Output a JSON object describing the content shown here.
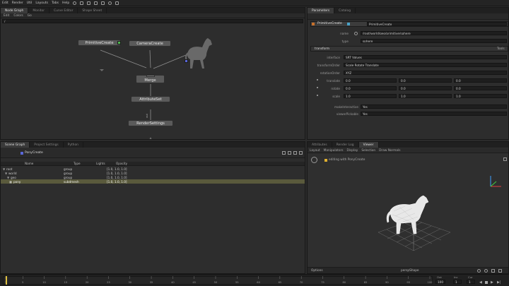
{
  "menu": [
    "Edit",
    "Render",
    "Util",
    "Layouts",
    "Tabs",
    "Help"
  ],
  "node_graph": {
    "tabs": [
      "Node Graph",
      "Monitor",
      "Curve Editor",
      "Shape Sheet"
    ],
    "toolbar": [
      "Edit",
      "Colors",
      "Go"
    ],
    "path": "/",
    "nodes": {
      "primitive": "PrimitiveCreate",
      "camera": "CameraCreate",
      "merge": "Merge",
      "attr": "AttributeSet",
      "render": "RenderSettings"
    },
    "link_label": "out"
  },
  "parameters": {
    "tabs": [
      "Parameters",
      "Catalog"
    ],
    "node_name": "PrimitiveCreate",
    "rows": [
      {
        "label": "name",
        "value": "/root/world/geo/primitive/sphere"
      },
      {
        "label": "type",
        "value": "sphere"
      }
    ],
    "section": "transform",
    "tools": "Tools",
    "xform": [
      {
        "label": "interface",
        "value": "SRT Values"
      },
      {
        "label": "transformOrder",
        "value": "Scale Rotate Translate"
      },
      {
        "label": "rotationOrder",
        "value": "XYZ"
      }
    ],
    "vectors": [
      {
        "label": "translate",
        "x": "0.0",
        "y": "0.0",
        "z": "0.0"
      },
      {
        "label": "rotate",
        "x": "0.0",
        "y": "0.0",
        "z": "0.0"
      },
      {
        "label": "scale",
        "x": "1.0",
        "y": "1.0",
        "z": "1.0"
      }
    ],
    "flags": [
      {
        "label": "makeInteractive",
        "value": "Yes"
      },
      {
        "label": "viewerPickable",
        "value": "Yes"
      }
    ]
  },
  "scene_graph": {
    "tabs": [
      "Scene Graph",
      "Project Settings",
      "Python"
    ],
    "viewing": "PonyCreate",
    "columns": [
      "Name",
      "Type",
      "Lights",
      "Opacity"
    ],
    "rows": [
      {
        "name": "root",
        "type": "group",
        "opacity": "[1.0, 1.0, 1.0]"
      },
      {
        "name": "world",
        "type": "group",
        "opacity": "[1.0, 1.0, 1.0]"
      },
      {
        "name": "geo",
        "type": "group",
        "opacity": "[1.0, 1.0, 1.0]"
      },
      {
        "name": "pony",
        "type": "subdmesh",
        "opacity": "[1.0, 1.0, 1.0]"
      }
    ]
  },
  "viewer": {
    "tabs": [
      "Attributes",
      "Render Log",
      "Viewer"
    ],
    "menu": [
      "Layout",
      "Manipulators",
      "Display",
      "Selection",
      "Draw Normals"
    ],
    "editing": "editing with PonyCreate",
    "options": "Options",
    "camera": "perspShape"
  },
  "timeline": {
    "ticks": [
      "1",
      "5",
      "10",
      "15",
      "20",
      "25",
      "30",
      "35",
      "40",
      "45",
      "50",
      "55",
      "60",
      "65",
      "70",
      "75",
      "80",
      "85",
      "90",
      "95",
      "100"
    ],
    "out": "Out",
    "out_val": "100",
    "inc": "Inc",
    "inc_val": "1",
    "cur": "Cur",
    "cur_val": "1"
  }
}
